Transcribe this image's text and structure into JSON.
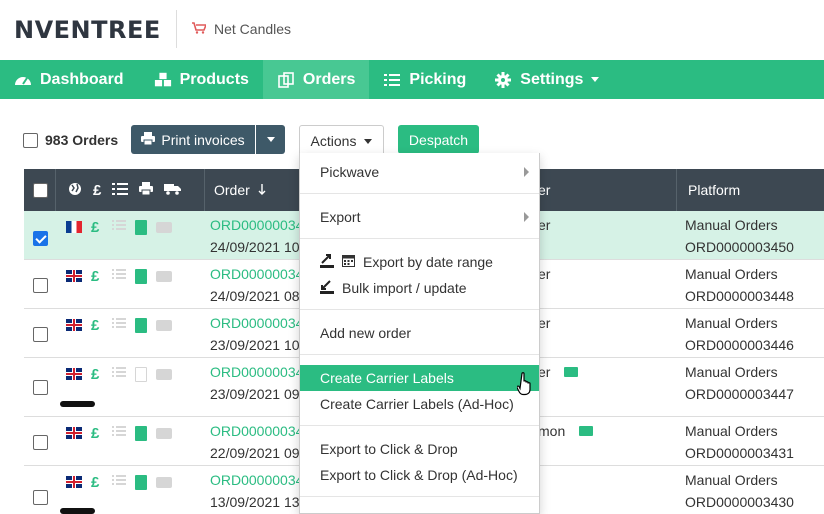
{
  "brand": "NVENTREE",
  "store_name": "Net Candles",
  "nav": [
    {
      "label": "Dashboard",
      "icon": "dashboard-icon"
    },
    {
      "label": "Products",
      "icon": "cubes-icon"
    },
    {
      "label": "Orders",
      "icon": "orders-icon"
    },
    {
      "label": "Picking",
      "icon": "list-icon"
    },
    {
      "label": "Settings",
      "icon": "gear-icon"
    }
  ],
  "toolbar": {
    "order_count": "983 Orders",
    "print_label": "Print invoices",
    "actions_label": "Actions",
    "despatch_label": "Despatch"
  },
  "table": {
    "headers": {
      "order": "Order",
      "customer_partial": "er",
      "platform": "Platform"
    },
    "rows": [
      {
        "order": "ORD00000034",
        "date": "24/09/2021 10",
        "customer": "er",
        "platform": "Manual Orders",
        "ref": "ORD0000003450",
        "flag": "fr",
        "selected": true
      },
      {
        "order": "ORD00000034",
        "date": "24/09/2021 08",
        "customer": "er",
        "platform": "Manual Orders",
        "ref": "ORD0000003448",
        "flag": "uk",
        "selected": false
      },
      {
        "order": "ORD00000034",
        "date": "23/09/2021 10",
        "customer": "er",
        "platform": "Manual Orders",
        "ref": "ORD0000003446",
        "flag": "uk",
        "selected": false
      },
      {
        "order": "ORD00000034",
        "date": "23/09/2021 09",
        "customer": "er",
        "platform": "Manual Orders",
        "ref": "ORD0000003447",
        "flag": "uk",
        "selected": false
      },
      {
        "order": "ORD00000034",
        "date": "22/09/2021 09",
        "customer": "mon",
        "platform": "Manual Orders",
        "ref": "ORD0000003431",
        "flag": "uk",
        "selected": false
      },
      {
        "order": "ORD00000034",
        "date": "13/09/2021 13",
        "customer": "",
        "platform": "Manual Orders",
        "ref": "ORD0000003430",
        "flag": "uk",
        "selected": false
      }
    ]
  },
  "menu": {
    "pickwave": "Pickwave",
    "export": "Export",
    "export_date": "Export by date range",
    "bulk_import": "Bulk import / update",
    "add_order": "Add new order",
    "carrier_labels": "Create Carrier Labels",
    "carrier_labels_adhoc": "Create Carrier Labels (Ad-Hoc)",
    "click_drop": "Export to Click & Drop",
    "click_drop_adhoc": "Export to Click & Drop (Ad-Hoc)"
  },
  "colors": {
    "brand_green": "#2bbc82",
    "header_dark": "#3d4852",
    "button_dark": "#3e5968"
  }
}
